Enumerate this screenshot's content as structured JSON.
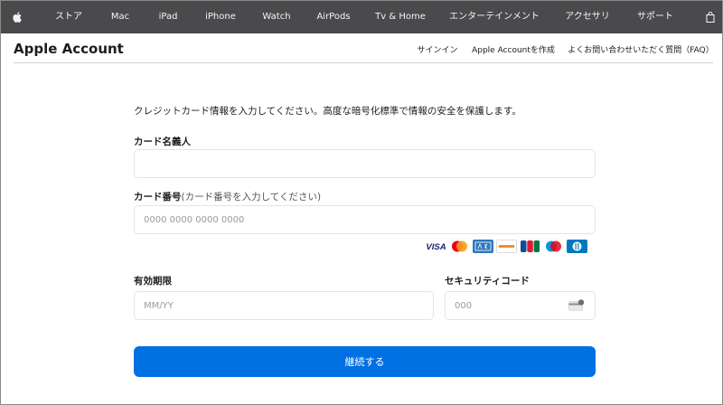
{
  "global_nav": {
    "apple_logo": "apple-logo",
    "items": [
      "ストア",
      "Mac",
      "iPad",
      "iPhone",
      "Watch",
      "AirPods",
      "Tv & Home",
      "エンターテインメント",
      "アクセサリ",
      "サポート"
    ],
    "bag_icon": "bag-icon"
  },
  "local_nav": {
    "title": "Apple Account",
    "links": [
      "サインイン",
      "Apple Accountを作成",
      "よくお問い合わせいただく質問（FAQ）"
    ]
  },
  "form": {
    "intro": "クレジットカード情報を入力してください。高度な暗号化標準で情報の安全を保護します。",
    "cardholder_label": "カード名義人",
    "cardholder_value": "",
    "card_number_label": "カード番号",
    "card_number_hint": "(カード番号を入力してください)",
    "card_number_placeholder": "0000 0000 0000 0000",
    "card_brands": [
      "VISA",
      "Mastercard",
      "American Express",
      "DISCOVER",
      "JCB",
      "Maestro",
      "Diners Club"
    ],
    "expiry_label": "有効期限",
    "expiry_placeholder": "MM/YY",
    "security_label": "セキュリティコード",
    "security_placeholder": "000",
    "submit_label": "継続する"
  },
  "colors": {
    "nav_bg": "#4a4a4c",
    "primary_button": "#0071e3",
    "border": "#e4e4e8"
  }
}
